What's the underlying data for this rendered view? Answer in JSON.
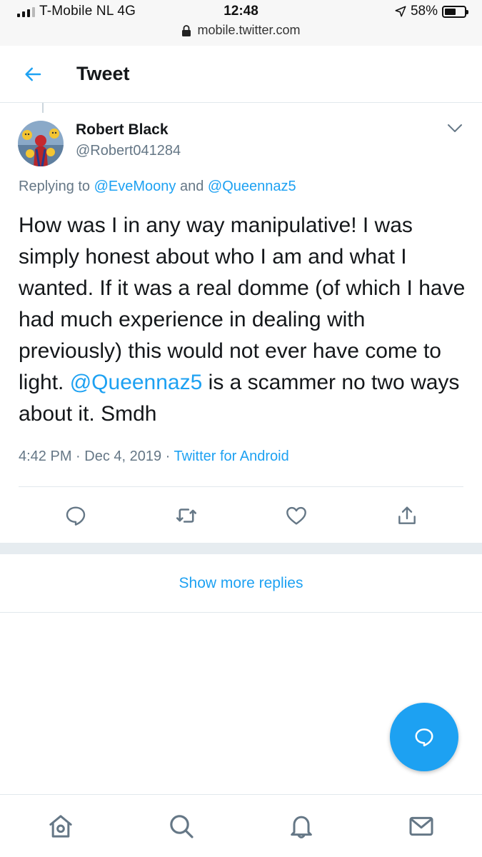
{
  "status_bar": {
    "carrier": "T-Mobile NL  4G",
    "time": "12:48",
    "battery_percent": "58%",
    "battery_level": 0.58,
    "url": "mobile.twitter.com"
  },
  "header": {
    "title": "Tweet",
    "back_icon": "arrow-left-icon"
  },
  "tweet": {
    "author_name": "Robert Black",
    "author_handle": "@Robert041284",
    "replying": {
      "prefix": "Replying to ",
      "mention1": "@EveMoony",
      "conjunction": " and ",
      "mention2": "@Queennaz5"
    },
    "text_part1": "How was I in any way manipulative! I was simply honest about who I am and what I wanted. If it was a real domme (of which I have had much experience in dealing with previously) this would not ever have come to light. ",
    "text_mention": "@Queennaz5",
    "text_part2": " is a scammer no two ways about it. Smdh",
    "time": "4:42 PM",
    "separator": " · ",
    "date": "Dec 4, 2019",
    "source": "Twitter for Android"
  },
  "actions": {
    "reply_icon": "reply-icon",
    "retweet_icon": "retweet-icon",
    "like_icon": "heart-icon",
    "share_icon": "share-icon"
  },
  "show_more_label": "Show more replies",
  "bottom_nav": {
    "home_icon": "home-icon",
    "search_icon": "search-icon",
    "notifications_icon": "bell-icon",
    "messages_icon": "mail-icon"
  },
  "colors": {
    "accent": "#1da1f2",
    "secondary_text": "#657786",
    "primary_text": "#14171a",
    "divider": "#e1e8ed"
  }
}
